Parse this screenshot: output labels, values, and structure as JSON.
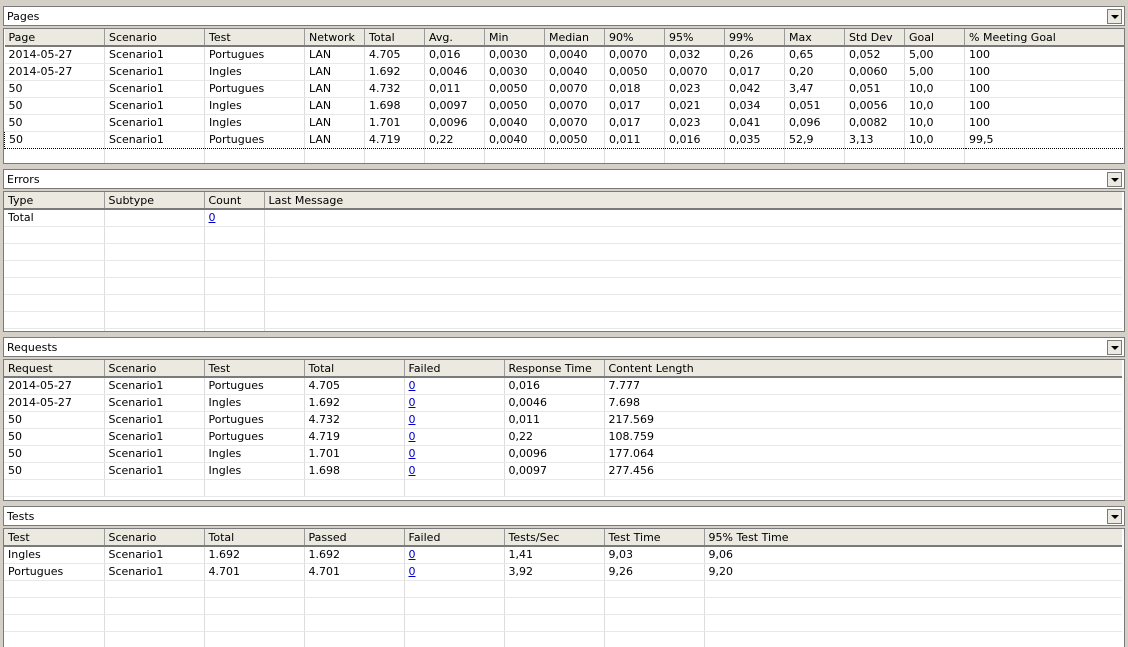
{
  "pages": {
    "title": "Pages",
    "columns": [
      "Page",
      "Scenario",
      "Test",
      "Network",
      "Total",
      "Avg.",
      "Min",
      "Median",
      "90%",
      "95%",
      "99%",
      "Max",
      "Std Dev",
      "Goal",
      "% Meeting Goal"
    ],
    "rows": [
      [
        "2014-05-27",
        "Scenario1",
        "Portugues",
        "LAN",
        "4.705",
        "0,016",
        "0,0030",
        "0,0040",
        "0,0070",
        "0,032",
        "0,26",
        "0,65",
        "0,052",
        "5,00",
        "100"
      ],
      [
        "2014-05-27",
        "Scenario1",
        "Ingles",
        "LAN",
        "1.692",
        "0,0046",
        "0,0030",
        "0,0040",
        "0,0050",
        "0,0070",
        "0,017",
        "0,20",
        "0,0060",
        "5,00",
        "100"
      ],
      [
        "50",
        "Scenario1",
        "Portugues",
        "LAN",
        "4.732",
        "0,011",
        "0,0050",
        "0,0070",
        "0,018",
        "0,023",
        "0,042",
        "3,47",
        "0,051",
        "10,0",
        "100"
      ],
      [
        "50",
        "Scenario1",
        "Ingles",
        "LAN",
        "1.698",
        "0,0097",
        "0,0050",
        "0,0070",
        "0,017",
        "0,021",
        "0,034",
        "0,051",
        "0,0056",
        "10,0",
        "100"
      ],
      [
        "50",
        "Scenario1",
        "Ingles",
        "LAN",
        "1.701",
        "0,0096",
        "0,0040",
        "0,0070",
        "0,017",
        "0,023",
        "0,041",
        "0,096",
        "0,0082",
        "10,0",
        "100"
      ],
      [
        "50",
        "Scenario1",
        "Portugues",
        "LAN",
        "4.719",
        "0,22",
        "0,0040",
        "0,0050",
        "0,011",
        "0,016",
        "0,035",
        "52,9",
        "3,13",
        "10,0",
        "99,5"
      ]
    ]
  },
  "errors": {
    "title": "Errors",
    "columns": [
      "Type",
      "Subtype",
      "Count",
      "Last Message"
    ],
    "rows": [
      [
        "Total",
        "",
        "0",
        ""
      ]
    ]
  },
  "requests": {
    "title": "Requests",
    "columns": [
      "Request",
      "Scenario",
      "Test",
      "Total",
      "Failed",
      "Response Time",
      "Content Length"
    ],
    "rows": [
      [
        "2014-05-27",
        "Scenario1",
        "Portugues",
        "4.705",
        "0",
        "0,016",
        "7.777"
      ],
      [
        "2014-05-27",
        "Scenario1",
        "Ingles",
        "1.692",
        "0",
        "0,0046",
        "7.698"
      ],
      [
        "50",
        "Scenario1",
        "Portugues",
        "4.732",
        "0",
        "0,011",
        "217.569"
      ],
      [
        "50",
        "Scenario1",
        "Portugues",
        "4.719",
        "0",
        "0,22",
        "108.759"
      ],
      [
        "50",
        "Scenario1",
        "Ingles",
        "1.701",
        "0",
        "0,0096",
        "177.064"
      ],
      [
        "50",
        "Scenario1",
        "Ingles",
        "1.698",
        "0",
        "0,0097",
        "277.456"
      ]
    ]
  },
  "tests": {
    "title": "Tests",
    "columns": [
      "Test",
      "Scenario",
      "Total",
      "Passed",
      "Failed",
      "Tests/Sec",
      "Test Time",
      "95% Test Time"
    ],
    "rows": [
      [
        "Ingles",
        "Scenario1",
        "1.692",
        "1.692",
        "0",
        "1,41",
        "9,03",
        "9,06"
      ],
      [
        "Portugues",
        "Scenario1",
        "4.701",
        "4.701",
        "0",
        "3,92",
        "9,26",
        "9,20"
      ]
    ]
  }
}
